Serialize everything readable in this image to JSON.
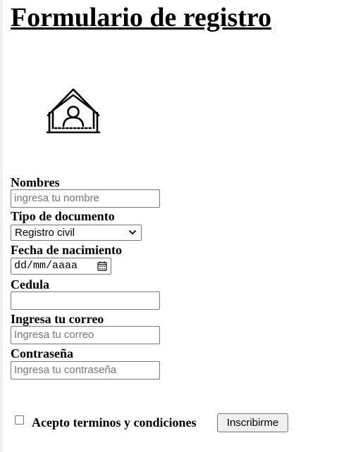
{
  "page": {
    "title": "Formulario de registro"
  },
  "icons": {
    "header_icon": "house-user-icon",
    "select_arrow": "chevron-down-icon",
    "date_picker": "calendar-icon"
  },
  "form": {
    "nombres": {
      "label": "Nombres",
      "placeholder": "ingresa tu nombre",
      "value": ""
    },
    "tipo_documento": {
      "label": "Tipo de documento",
      "selected": "Registro civil"
    },
    "fecha_nacimiento": {
      "label": "Fecha de nacimiento",
      "placeholder": "dd/mm/aaaa"
    },
    "cedula": {
      "label": "Cedula",
      "value": ""
    },
    "correo": {
      "label": "Ingresa tu correo",
      "placeholder": "Ingresa tu correo",
      "value": ""
    },
    "contrasena": {
      "label": "Contraseña",
      "placeholder": "Ingresa tu contraseña",
      "value": ""
    },
    "terms": {
      "label": "Acepto terminos y condiciones",
      "checked": false
    },
    "submit_label": "Inscribirme"
  }
}
